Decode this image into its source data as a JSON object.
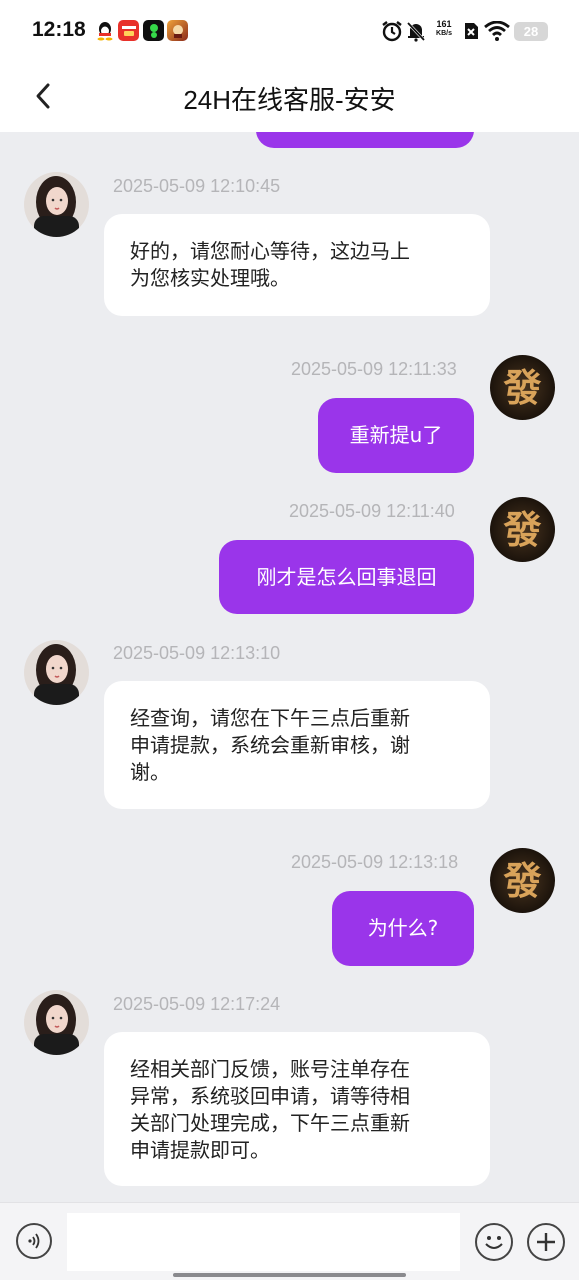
{
  "status_bar": {
    "time": "12:18",
    "net_speed_value": "161",
    "net_speed_unit": "KB/s",
    "battery": "28",
    "icons": [
      "qq-icon",
      "news-app-icon",
      "green-app-icon",
      "game-app-icon",
      "alarm-icon",
      "mute-bell-icon",
      "sim-x-icon",
      "wifi-icon",
      "battery-icon"
    ]
  },
  "header": {
    "title": "24H在线客服-安安",
    "back_icon": "chevron-left-icon"
  },
  "colors": {
    "accent_bubble": "#9a35ea",
    "background": "#ecedf0",
    "agent_bubble": "#ffffff",
    "timestamp": "#b5b5b8"
  },
  "messages": [
    {
      "side": "left",
      "time": "2025-05-09 12:10:45",
      "lines": [
        "好的，请您耐心等待，这边马上",
        "为您核实处理哦。"
      ]
    },
    {
      "side": "right",
      "time": "2025-05-09 12:11:33",
      "text": "重新提u了"
    },
    {
      "side": "right",
      "time": "2025-05-09 12:11:40",
      "text": "刚才是怎么回事退回"
    },
    {
      "side": "left",
      "time": "2025-05-09 12:13:10",
      "lines": [
        "经查询，请您在下午三点后重新",
        "申请提款，系统会重新审核，谢",
        "谢。"
      ]
    },
    {
      "side": "right",
      "time": "2025-05-09 12:13:18",
      "text": "为什么?"
    },
    {
      "side": "left",
      "time": "2025-05-09 12:17:24",
      "lines": [
        "经相关部门反馈，账号注单存在",
        "异常，系统驳回申请，请等待相",
        "关部门处理完成，下午三点重新",
        "申请提款即可。"
      ]
    }
  ],
  "user_avatar_glyph": "發",
  "input_bar": {
    "placeholder": "",
    "icons": [
      "voice-icon",
      "emoji-icon",
      "plus-icon"
    ]
  }
}
